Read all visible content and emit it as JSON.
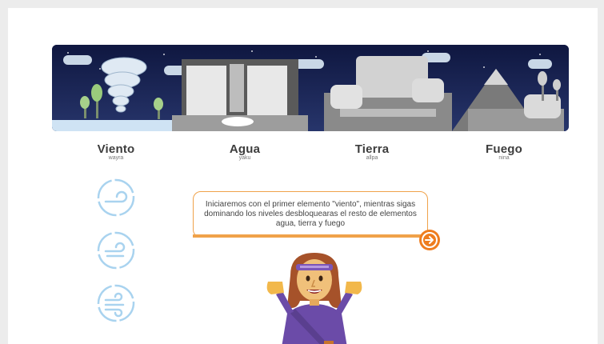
{
  "elements": [
    {
      "name": "Viento",
      "sub": "wayra"
    },
    {
      "name": "Agua",
      "sub": "yaku"
    },
    {
      "name": "Tierra",
      "sub": "allpa"
    },
    {
      "name": "Fuego",
      "sub": "nina"
    }
  ],
  "levels": [
    "wind-level-1-icon",
    "wind-level-2-icon",
    "wind-level-3-icon"
  ],
  "dialog": {
    "text": "Iniciaremos con el primer elemento \"viento\", mientras sigas dominando los niveles desbloquearas el resto de elementos agua, tierra y fuego"
  },
  "colors": {
    "accent": "#ef7d1f",
    "bubble_border": "#f0a24a",
    "banner_sky": "#1b2552",
    "level_icon": "#a9d3ef"
  }
}
